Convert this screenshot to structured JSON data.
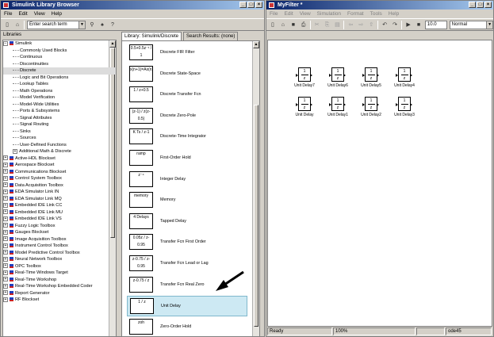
{
  "browser": {
    "title": "Simulink Library Browser",
    "menu": [
      "File",
      "Edit",
      "View",
      "Help"
    ],
    "search_value": "Enter search term",
    "libraries_label": "Libraries",
    "tabs": [
      "Library: Simulink/Discrete",
      "Search Results: (none)"
    ],
    "tree": [
      {
        "label": "Simulink",
        "level": 0,
        "expanded": true
      },
      {
        "label": "Commonly Used Blocks",
        "level": 1
      },
      {
        "label": "Continuous",
        "level": 1
      },
      {
        "label": "Discontinuities",
        "level": 1
      },
      {
        "label": "Discrete",
        "level": 1,
        "selected": true
      },
      {
        "label": "Logic and Bit Operations",
        "level": 1
      },
      {
        "label": "Lookup Tables",
        "level": 1
      },
      {
        "label": "Math Operations",
        "level": 1
      },
      {
        "label": "Model Verification",
        "level": 1
      },
      {
        "label": "Model-Wide Utilities",
        "level": 1
      },
      {
        "label": "Ports & Subsystems",
        "level": 1
      },
      {
        "label": "Signal Attributes",
        "level": 1
      },
      {
        "label": "Signal Routing",
        "level": 1
      },
      {
        "label": "Sinks",
        "level": 1
      },
      {
        "label": "Sources",
        "level": 1
      },
      {
        "label": "User-Defined Functions",
        "level": 1
      },
      {
        "label": "Additional Math & Discrete",
        "level": 1,
        "expandable": true
      },
      {
        "label": "Active-HDL Blockset",
        "level": 0
      },
      {
        "label": "Aerospace Blockset",
        "level": 0
      },
      {
        "label": "Communications Blockset",
        "level": 0
      },
      {
        "label": "Control System Toolbox",
        "level": 0
      },
      {
        "label": "Data Acquisition Toolbox",
        "level": 0
      },
      {
        "label": "EDA Simulator Link IN",
        "level": 0
      },
      {
        "label": "EDA Simulator Link MQ",
        "level": 0
      },
      {
        "label": "Embedded IDE Link CC",
        "level": 0
      },
      {
        "label": "Embedded IDE Link MU",
        "level": 0
      },
      {
        "label": "Embedded IDE Link VS",
        "level": 0
      },
      {
        "label": "Fuzzy Logic Toolbox",
        "level": 0
      },
      {
        "label": "Gauges Blockset",
        "level": 0
      },
      {
        "label": "Image Acquisition Toolbox",
        "level": 0
      },
      {
        "label": "Instrument Control Toolbox",
        "level": 0
      },
      {
        "label": "Model Predictive Control Toolbox",
        "level": 0
      },
      {
        "label": "Neural Network Toolbox",
        "level": 0
      },
      {
        "label": "OPC Toolbox",
        "level": 0
      },
      {
        "label": "Real-Time Windows Target",
        "level": 0
      },
      {
        "label": "Real-Time Workshop",
        "level": 0
      },
      {
        "label": "Real-Time Workshop Embedded Coder",
        "level": 0
      },
      {
        "label": "Report Generator",
        "level": 0
      },
      {
        "label": "RF Blockset",
        "level": 0
      }
    ],
    "blocks": [
      {
        "label": "Discrete FIR Filter",
        "icon": "0.5+0.5z⁻¹ / 1"
      },
      {
        "label": "Discrete State-Space",
        "icon": "x(n+1)=Ax(n)+Bu(n)"
      },
      {
        "label": "Discrete Transfer Fcn",
        "icon": "1 / z+0.5"
      },
      {
        "label": "Discrete Zero-Pole",
        "icon": "(z-1) / z(z-0.5)"
      },
      {
        "label": "Discrete-Time Integrator",
        "icon": "K Ts / z-1"
      },
      {
        "label": "First-Order Hold",
        "icon": "ramp"
      },
      {
        "label": "Integer Delay",
        "icon": "z⁻⁴"
      },
      {
        "label": "Memory",
        "icon": "memory"
      },
      {
        "label": "Tapped Delay",
        "icon": "4 Delays"
      },
      {
        "label": "Transfer Fcn First Order",
        "icon": "0.05z / z-0.95"
      },
      {
        "label": "Transfer Fcn Lead or Lag",
        "icon": "z-0.75 / z-0.95"
      },
      {
        "label": "Transfer Fcn Real Zero",
        "icon": "z-0.75 / z"
      },
      {
        "label": "Unit Delay",
        "icon": "1 / z",
        "highlighted": true
      },
      {
        "label": "Zero-Order Hold",
        "icon": "zoh"
      }
    ]
  },
  "model": {
    "title": "MyFilter *",
    "menu": [
      "File",
      "Edit",
      "View",
      "Simulation",
      "Format",
      "Tools",
      "Help"
    ],
    "stop_time": "10.0",
    "mode": "Normal",
    "blocks": [
      {
        "name": "Unit Delay7",
        "num": "1",
        "den": "z"
      },
      {
        "name": "Unit Delay6",
        "num": "1",
        "den": "z"
      },
      {
        "name": "Unit Delay5",
        "num": "1",
        "den": "z"
      },
      {
        "name": "Unit Delay4",
        "num": "1",
        "den": "z"
      },
      {
        "name": "Unit Delay",
        "num": "1",
        "den": "z"
      },
      {
        "name": "Unit Delay1",
        "num": "1",
        "den": "z"
      },
      {
        "name": "Unit Delay2",
        "num": "1",
        "den": "z"
      },
      {
        "name": "Unit Delay3",
        "num": "1",
        "den": "z"
      }
    ],
    "status": [
      "Ready",
      "100%",
      "",
      "ode45"
    ]
  }
}
